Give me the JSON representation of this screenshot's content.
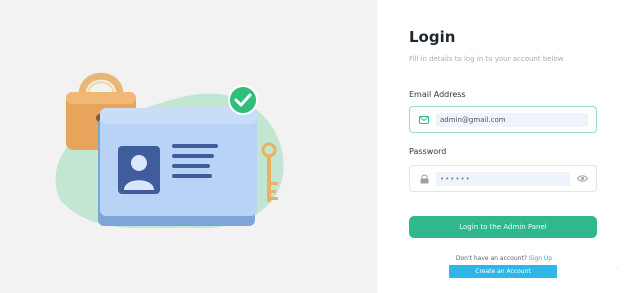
{
  "login": {
    "title": "Login",
    "subtitle": "Fill in details to log in to your account below",
    "email_label": "Email Address",
    "email_value": "admin@gmail.com",
    "password_label": "Password",
    "password_value": "••••••",
    "login_button": "Login to the Admin Panel",
    "signup_prompt": "Don't have an account?",
    "signup_link": "Sign Up",
    "create_button": "Create an Account",
    "corner_text": "..."
  },
  "icons": {
    "email": "mail-icon",
    "password": "lock-icon",
    "eye": "eye-icon",
    "check": "check-icon"
  },
  "colors": {
    "accent": "#2fb88d",
    "link": "#2fb6e8",
    "card": "#b9d5f6",
    "blob": "#bfe4cf",
    "lock": "#e8a45a"
  }
}
